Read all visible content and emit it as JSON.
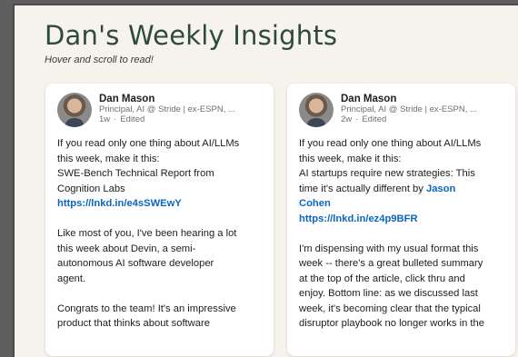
{
  "page": {
    "title": "Dan's Weekly Insights",
    "subtitle": "Hover and scroll to read!"
  },
  "posts": [
    {
      "author": "Dan Mason",
      "headline": "Principal, AI @ Stride | ex-ESPN, ...",
      "age": "1w",
      "edited": "Edited",
      "lines": [
        "If you read only one thing about AI/LLMs",
        "this week, make it this:",
        "SWE-Bench Technical Report from",
        "Cognition Labs"
      ],
      "link": "https://lnkd.in/e4sSWEwY",
      "paragraph2": [
        "Like most of you, I've been hearing a lot",
        "this week about Devin, a semi-",
        "autonomous AI software developer",
        "agent."
      ],
      "paragraph3": [
        "Congrats to the team! It's an impressive",
        "product that thinks about software"
      ]
    },
    {
      "author": "Dan Mason",
      "headline": "Principal, AI @ Stride | ex-ESPN, ...",
      "age": "2w",
      "edited": "Edited",
      "lines": [
        "If you read only one thing about AI/LLMs",
        "this week, make it this:",
        "AI startups require new strategies: This",
        "time it's actually different by"
      ],
      "mention_first": "Jason",
      "mention_second": "Cohen",
      "link": "https://lnkd.in/ez4p9BFR",
      "paragraph2": [
        "I'm dispensing with my usual format this",
        "week -- there's a great bulleted summary",
        "at the top of the article, click thru and",
        "enjoy.  Bottom line: as we discussed last",
        "week, it's becoming clear that the typical",
        "disruptor playbook no longer works in the"
      ]
    }
  ],
  "colors": {
    "title": "#2e4a3c",
    "link": "#0a66c2",
    "background": "#f6f3ec"
  }
}
